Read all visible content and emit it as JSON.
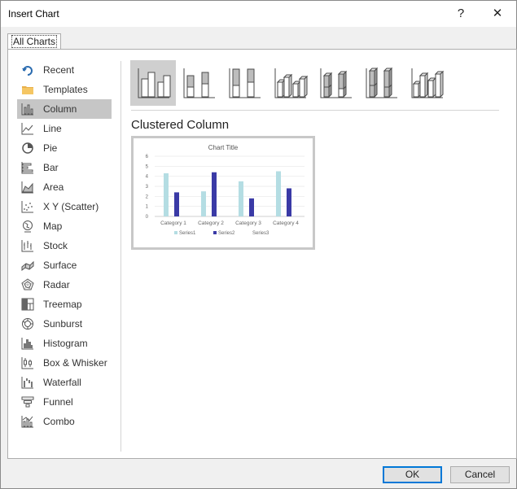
{
  "window": {
    "title": "Insert Chart",
    "help_glyph": "?",
    "close_glyph": "✕"
  },
  "tabs": [
    {
      "label": "All Charts"
    }
  ],
  "sidebar": {
    "items": [
      {
        "label": "Recent",
        "icon": "recent-icon"
      },
      {
        "label": "Templates",
        "icon": "templates-folder-icon"
      },
      {
        "label": "Column",
        "icon": "column-chart-icon",
        "selected": true
      },
      {
        "label": "Line",
        "icon": "line-chart-icon"
      },
      {
        "label": "Pie",
        "icon": "pie-chart-icon"
      },
      {
        "label": "Bar",
        "icon": "bar-chart-icon"
      },
      {
        "label": "Area",
        "icon": "area-chart-icon"
      },
      {
        "label": "X Y (Scatter)",
        "icon": "scatter-chart-icon"
      },
      {
        "label": "Map",
        "icon": "map-chart-icon"
      },
      {
        "label": "Stock",
        "icon": "stock-chart-icon"
      },
      {
        "label": "Surface",
        "icon": "surface-chart-icon"
      },
      {
        "label": "Radar",
        "icon": "radar-chart-icon"
      },
      {
        "label": "Treemap",
        "icon": "treemap-chart-icon"
      },
      {
        "label": "Sunburst",
        "icon": "sunburst-chart-icon"
      },
      {
        "label": "Histogram",
        "icon": "histogram-chart-icon"
      },
      {
        "label": "Box & Whisker",
        "icon": "box-whisker-chart-icon"
      },
      {
        "label": "Waterfall",
        "icon": "waterfall-chart-icon"
      },
      {
        "label": "Funnel",
        "icon": "funnel-chart-icon"
      },
      {
        "label": "Combo",
        "icon": "combo-chart-icon"
      }
    ]
  },
  "subtypes": [
    {
      "icon": "clustered-column-icon",
      "selected": true
    },
    {
      "icon": "stacked-column-icon"
    },
    {
      "icon": "100-percent-stacked-column-icon"
    },
    {
      "icon": "3d-clustered-column-icon"
    },
    {
      "icon": "3d-stacked-column-icon"
    },
    {
      "icon": "3d-100-percent-stacked-column-icon"
    },
    {
      "icon": "3d-column-icon"
    }
  ],
  "main": {
    "chart_heading": "Clustered Column"
  },
  "colors": {
    "series1": "#b4dde3",
    "series2": "#3a3aa6",
    "series3": "#cfcfcf",
    "accent": "#0078d7"
  },
  "chart_data": {
    "type": "bar",
    "title": "Chart Title",
    "categories": [
      "Category 1",
      "Category 2",
      "Category 3",
      "Category 4"
    ],
    "series": [
      {
        "name": "Series1",
        "values": [
          4.3,
          2.5,
          3.5,
          4.5
        ]
      },
      {
        "name": "Series2",
        "values": [
          2.4,
          4.4,
          1.8,
          2.8
        ]
      },
      {
        "name": "Series3",
        "values": [
          0,
          0,
          0,
          0
        ]
      }
    ],
    "ylim": [
      0,
      6
    ],
    "yticks": [
      "0",
      "1",
      "2",
      "3",
      "4",
      "5",
      "6"
    ],
    "grid": true,
    "legend": "bottom"
  },
  "buttons": {
    "ok": "OK",
    "cancel": "Cancel"
  }
}
